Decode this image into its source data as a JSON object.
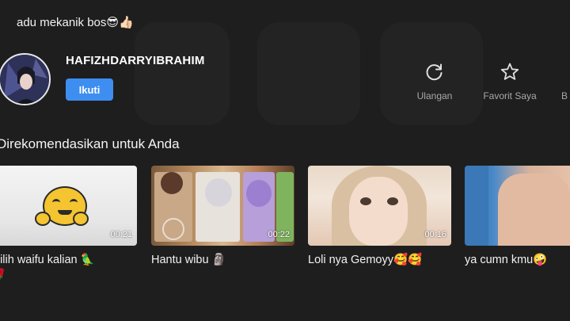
{
  "post": {
    "caption": "adu mekanik bos😎👍🏻"
  },
  "uploader": {
    "name": "HAFIZHDARRYIBRAHIM",
    "follow_label": "Ikuti"
  },
  "actions": [
    {
      "label": "Ulangan",
      "icon": "replay-icon"
    },
    {
      "label": "Favorit Saya",
      "icon": "star-icon"
    },
    {
      "label": "B",
      "icon": "more-icon"
    }
  ],
  "recommendations": {
    "title": "Direkomendasikan untuk Anda",
    "items": [
      {
        "title": "pilih waifu kalian 🦜",
        "duration": "00:21",
        "extra": "🌹"
      },
      {
        "title": "Hantu wibu 🗿",
        "duration": "00:22"
      },
      {
        "title": "Loli nya Gemoyy🥰🥰",
        "duration": "00:16"
      },
      {
        "title": "ya cumn kmu🤪",
        "duration": ""
      }
    ]
  },
  "colors": {
    "background": "#1e1e1e",
    "accent": "#3d8ef0",
    "muted_text": "#a8a8a8"
  }
}
